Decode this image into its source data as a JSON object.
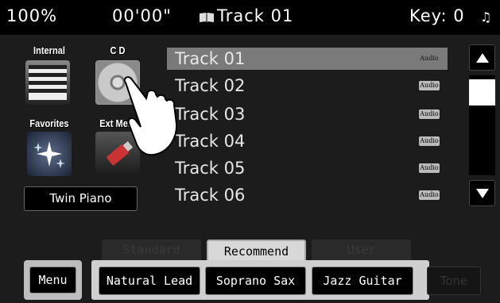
{
  "status": {
    "volume": "100%",
    "time": "00'00\"",
    "track_title": "Track 01",
    "key": "Key: 0",
    "icons": {
      "track": "book-icon",
      "note": "music-note-icon"
    }
  },
  "categories": [
    {
      "label": "Internal",
      "icon": "piano-keys-icon"
    },
    {
      "label": "C D",
      "icon": "cd-disc-icon"
    },
    {
      "label": "Favorites",
      "icon": "sparkle-stars-icon"
    },
    {
      "label": "Ext Mem",
      "icon": "usb-drive-icon"
    }
  ],
  "current_tone": "Twin Piano",
  "tracks": [
    {
      "name": "Track 01",
      "badge": "Audio",
      "selected": true
    },
    {
      "name": "Track 02",
      "badge": "Audio",
      "selected": false
    },
    {
      "name": "Track 03",
      "badge": "Audio",
      "selected": false
    },
    {
      "name": "Track 04",
      "badge": "Audio",
      "selected": false
    },
    {
      "name": "Track 05",
      "badge": "Audio",
      "selected": false
    },
    {
      "name": "Track 06",
      "badge": "Audio",
      "selected": false
    }
  ],
  "tabs": [
    {
      "label": "Standard",
      "active": false
    },
    {
      "label": "Recommend",
      "active": true
    },
    {
      "label": "User",
      "active": false
    }
  ],
  "menu_label": "Menu",
  "tones": [
    "Natural Lead",
    "Soprano Sax",
    "Jazz Guitar"
  ],
  "tone_button": "Tone",
  "colors": {
    "selected_row": "#7a7a7a",
    "panel": "#cfcfcf"
  }
}
